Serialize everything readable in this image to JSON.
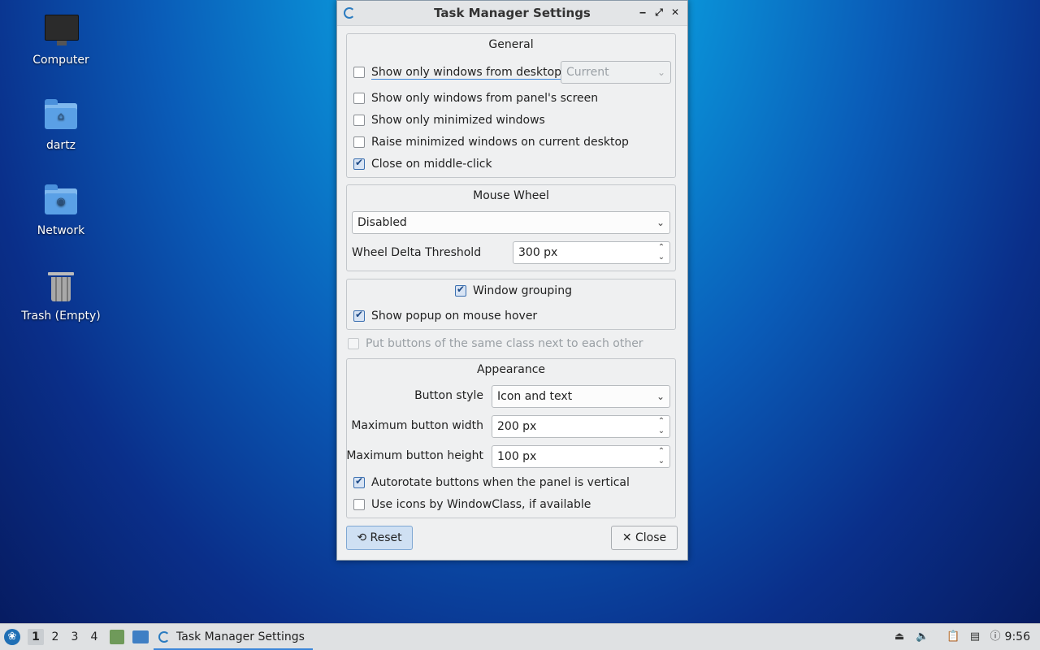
{
  "desktop": {
    "icons": [
      {
        "label": "Computer"
      },
      {
        "label": "dartz"
      },
      {
        "label": "Network"
      },
      {
        "label": "Trash (Empty)"
      }
    ]
  },
  "window": {
    "title": "Task Manager Settings",
    "buttons": {
      "minimize": "‒",
      "maximize": "⤢",
      "close": "✕"
    },
    "general": {
      "title": "General",
      "show_desktop_label": "Show only windows from desktop",
      "show_desktop_checked": false,
      "desktop_combo_value": "Current",
      "show_screen_label": "Show only windows from panel's screen",
      "show_screen_checked": false,
      "show_minimized_label": "Show only minimized windows",
      "show_minimized_checked": false,
      "raise_minimized_label": "Raise minimized windows on current desktop",
      "raise_minimized_checked": false,
      "close_middle_label": "Close on middle-click",
      "close_middle_checked": true
    },
    "mouse_wheel": {
      "title": "Mouse Wheel",
      "action_value": "Disabled",
      "threshold_label": "Wheel Delta Threshold",
      "threshold_value": "300 px"
    },
    "grouping": {
      "window_grouping_label": "Window grouping",
      "window_grouping_checked": true,
      "popup_label": "Show popup on mouse hover",
      "popup_checked": true
    },
    "same_class_label": "Put buttons of the same class next to each other",
    "same_class_checked": false,
    "appearance": {
      "title": "Appearance",
      "button_style_label": "Button style",
      "button_style_value": "Icon and text",
      "max_width_label": "Maximum button width",
      "max_width_value": "200 px",
      "max_height_label": "Maximum button height",
      "max_height_value": "100 px",
      "autorotate_label": "Autorotate buttons when the panel is vertical",
      "autorotate_checked": true,
      "windowclass_label": "Use icons by WindowClass, if available",
      "windowclass_checked": false
    },
    "reset_label": "Reset",
    "close_label": "Close"
  },
  "taskbar": {
    "workspaces": [
      "1",
      "2",
      "3",
      "4"
    ],
    "active_workspace": "1",
    "task_label": "Task Manager Settings",
    "clock": "9:56"
  }
}
